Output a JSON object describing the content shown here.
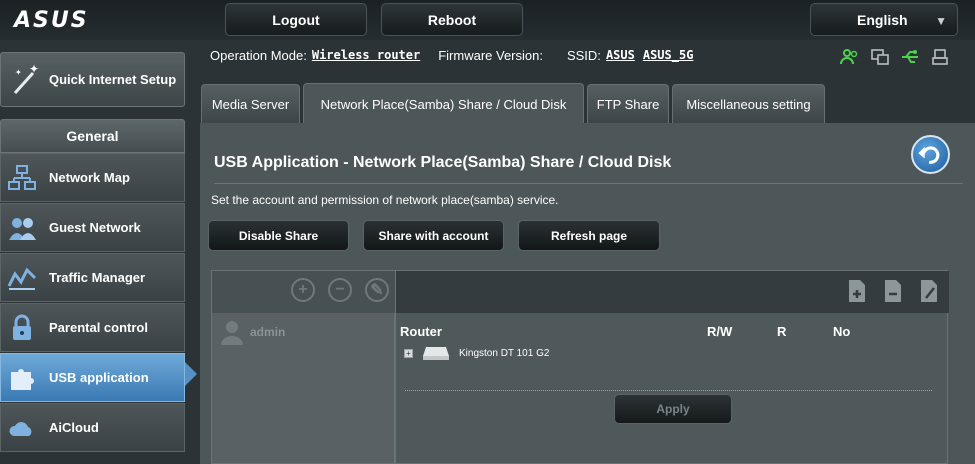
{
  "brand": "ASUS",
  "top": {
    "logout": "Logout",
    "reboot": "Reboot",
    "language": "English"
  },
  "status": {
    "op_mode_label": "Operation Mode:",
    "op_mode_value": "Wireless router",
    "fw_label": "Firmware Version:",
    "ssid_label": "SSID:",
    "ssid_1": "ASUS",
    "ssid_2": "ASUS_5G"
  },
  "sidebar": {
    "qis": "Quick Internet Setup",
    "general": "General",
    "items": [
      {
        "label": "Network Map",
        "icon": "network-map-icon"
      },
      {
        "label": "Guest Network",
        "icon": "guest-network-icon"
      },
      {
        "label": "Traffic Manager",
        "icon": "traffic-manager-icon"
      },
      {
        "label": "Parental control",
        "icon": "lock-icon"
      },
      {
        "label": "USB application",
        "icon": "puzzle-icon",
        "active": true
      },
      {
        "label": "AiCloud",
        "icon": "cloud-icon"
      }
    ]
  },
  "tabs": [
    {
      "label": "Media Server"
    },
    {
      "label": "Network Place(Samba) Share / Cloud Disk",
      "active": true
    },
    {
      "label": "FTP Share"
    },
    {
      "label": "Miscellaneous setting"
    }
  ],
  "main": {
    "title": "USB Application - Network Place(Samba) Share / Cloud Disk",
    "description": "Set the account and permission of network place(samba) service.",
    "buttons": {
      "disable": "Disable Share",
      "share_account": "Share with account",
      "refresh": "Refresh page"
    },
    "account": {
      "user": "admin"
    },
    "folders": {
      "root": "Router",
      "col_rw": "R/W",
      "col_r": "R",
      "col_no": "No",
      "device": "Kingston DT 101 G2",
      "apply": "Apply"
    }
  },
  "colors": {
    "active_nav": "#5591c4",
    "panel_bg": "#4d5659",
    "background": "#2b3336"
  }
}
